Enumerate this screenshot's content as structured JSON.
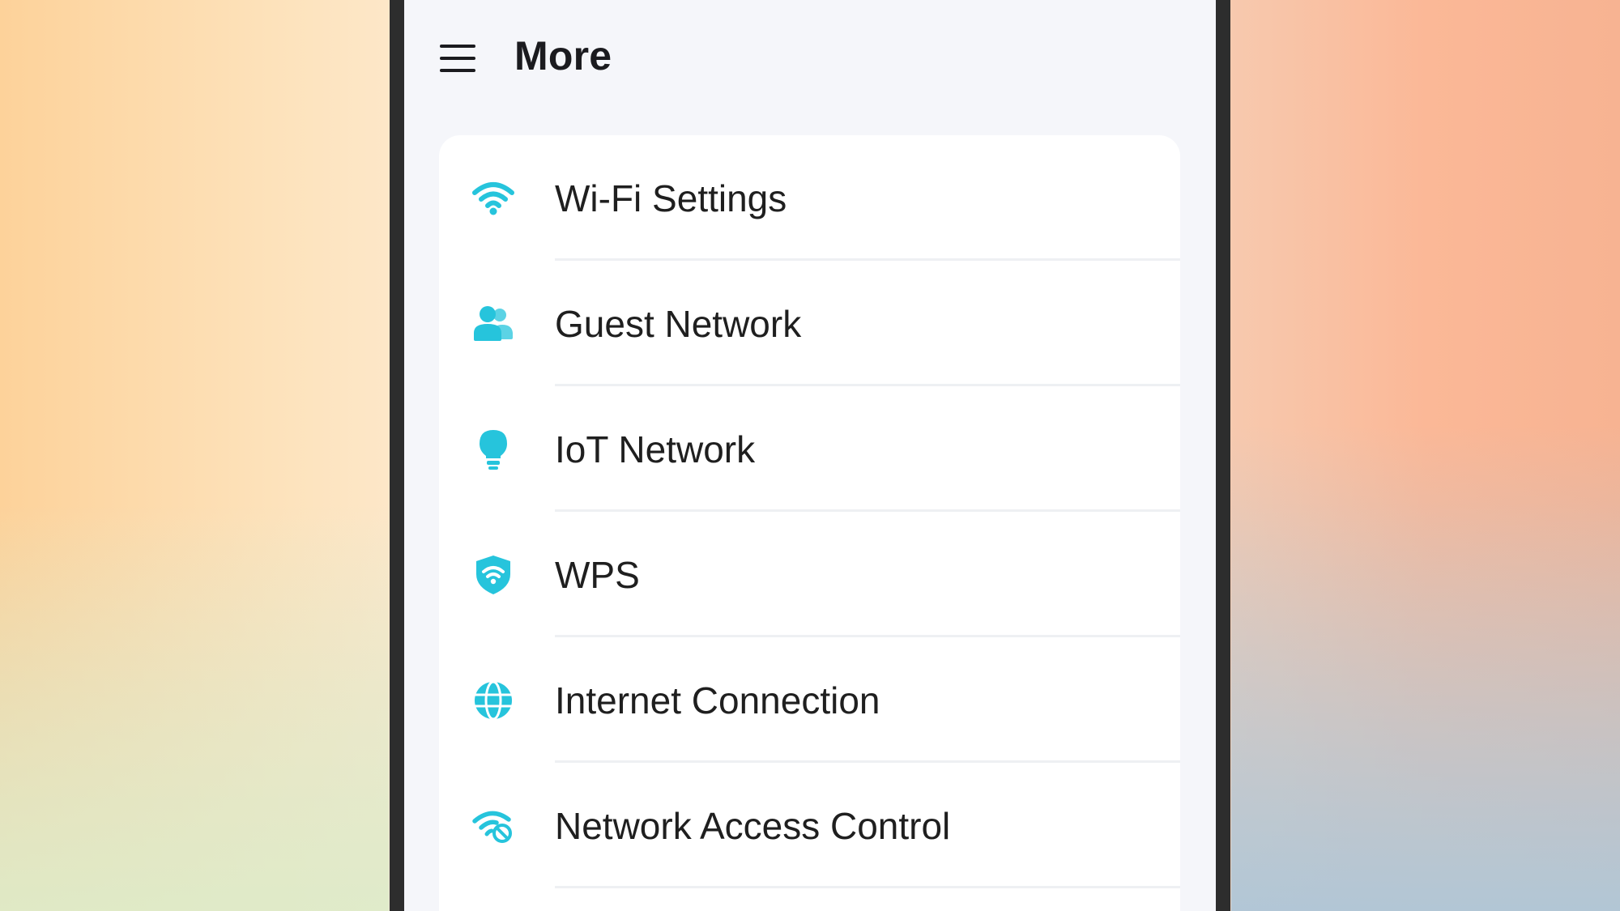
{
  "header": {
    "title": "More",
    "menu_icon": "hamburger-menu-icon"
  },
  "colors": {
    "accent": "#26c4dc",
    "screen_background": "#f5f6fa",
    "card_background": "#ffffff",
    "text": "#1f1f1f",
    "phone_frame": "#2d2d2d"
  },
  "menu": {
    "items": [
      {
        "label": "Wi-Fi Settings",
        "icon": "wifi-icon"
      },
      {
        "label": "Guest Network",
        "icon": "guest-users-icon"
      },
      {
        "label": "IoT Network",
        "icon": "lightbulb-icon"
      },
      {
        "label": "WPS",
        "icon": "wps-shield-icon"
      },
      {
        "label": "Internet Connection",
        "icon": "globe-icon"
      },
      {
        "label": "Network Access Control",
        "icon": "network-access-control-icon"
      }
    ]
  }
}
